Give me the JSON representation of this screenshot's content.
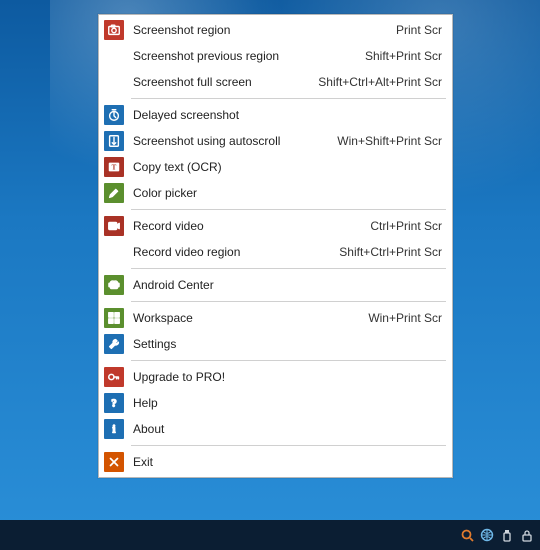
{
  "menu": {
    "groups": [
      [
        {
          "id": "screenshot-region",
          "label": "Screenshot region",
          "shortcut": "Print Scr",
          "icon": "camera-icon",
          "color": "c-red"
        },
        {
          "id": "screenshot-previous",
          "label": "Screenshot previous region",
          "shortcut": "Shift+Print Scr",
          "icon": "",
          "color": ""
        },
        {
          "id": "screenshot-full",
          "label": "Screenshot full screen",
          "shortcut": "Shift+Ctrl+Alt+Print Scr",
          "icon": "",
          "color": ""
        }
      ],
      [
        {
          "id": "delayed-screenshot",
          "label": "Delayed screenshot",
          "shortcut": "",
          "icon": "stopwatch-icon",
          "color": "c-blue"
        },
        {
          "id": "screenshot-autoscroll",
          "label": "Screenshot using autoscroll",
          "shortcut": "Win+Shift+Print Scr",
          "icon": "autoscroll-icon",
          "color": "c-blue"
        },
        {
          "id": "copy-text-ocr",
          "label": "Copy text (OCR)",
          "shortcut": "",
          "icon": "ocr-icon",
          "color": "c-dred"
        },
        {
          "id": "color-picker",
          "label": "Color picker",
          "shortcut": "",
          "icon": "eyedropper-icon",
          "color": "c-green"
        }
      ],
      [
        {
          "id": "record-video",
          "label": "Record video",
          "shortcut": "Ctrl+Print Scr",
          "icon": "video-icon",
          "color": "c-dred"
        },
        {
          "id": "record-video-region",
          "label": "Record video region",
          "shortcut": "Shift+Ctrl+Print Scr",
          "icon": "",
          "color": ""
        }
      ],
      [
        {
          "id": "android-center",
          "label": "Android Center",
          "shortcut": "",
          "icon": "android-icon",
          "color": "c-green"
        }
      ],
      [
        {
          "id": "workspace",
          "label": "Workspace",
          "shortcut": "Win+Print Scr",
          "icon": "workspace-icon",
          "color": "c-green"
        },
        {
          "id": "settings",
          "label": "Settings",
          "shortcut": "",
          "icon": "wrench-icon",
          "color": "c-blue"
        }
      ],
      [
        {
          "id": "upgrade-pro",
          "label": "Upgrade to PRO!",
          "shortcut": "",
          "icon": "key-icon",
          "color": "c-red"
        },
        {
          "id": "help",
          "label": "Help",
          "shortcut": "",
          "icon": "help-icon",
          "color": "c-blue"
        },
        {
          "id": "about",
          "label": "About",
          "shortcut": "",
          "icon": "info-icon",
          "color": "c-blue"
        }
      ],
      [
        {
          "id": "exit",
          "label": "Exit",
          "shortcut": "",
          "icon": "close-icon",
          "color": "c-orange"
        }
      ]
    ]
  },
  "tray": [
    {
      "id": "tray-search",
      "icon": "search-icon",
      "color": "#e07b2e"
    },
    {
      "id": "tray-globe",
      "icon": "globe-icon",
      "color": "#6fb8e8"
    },
    {
      "id": "tray-usb",
      "icon": "usb-icon",
      "color": "#cfd6dd"
    },
    {
      "id": "tray-lock",
      "icon": "lock-icon",
      "color": "#cfd6dd"
    }
  ]
}
